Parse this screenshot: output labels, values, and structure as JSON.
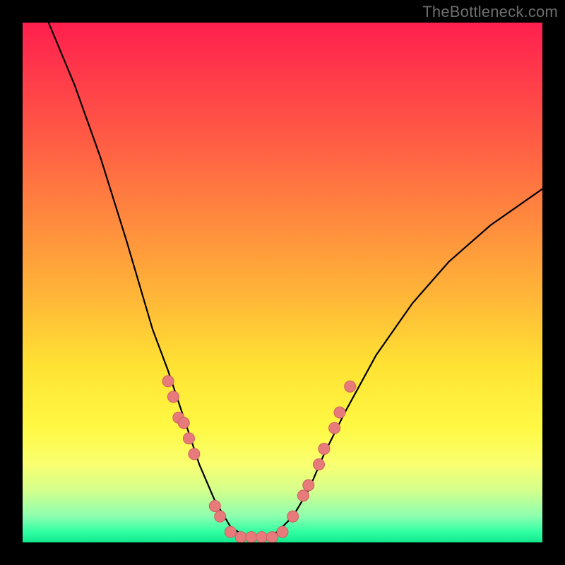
{
  "watermark": "TheBottleneck.com",
  "chart_data": {
    "type": "line",
    "title": "",
    "xlabel": "",
    "ylabel": "",
    "xlim": [
      0,
      100
    ],
    "ylim": [
      0,
      100
    ],
    "curve": [
      {
        "x": 5,
        "y": 100
      },
      {
        "x": 10,
        "y": 88
      },
      {
        "x": 15,
        "y": 74
      },
      {
        "x": 20,
        "y": 58
      },
      {
        "x": 25,
        "y": 41
      },
      {
        "x": 28,
        "y": 33
      },
      {
        "x": 31,
        "y": 24
      },
      {
        "x": 34,
        "y": 15
      },
      {
        "x": 37,
        "y": 8
      },
      {
        "x": 40,
        "y": 3
      },
      {
        "x": 43,
        "y": 1
      },
      {
        "x": 46,
        "y": 1
      },
      {
        "x": 49,
        "y": 2
      },
      {
        "x": 52,
        "y": 5
      },
      {
        "x": 55,
        "y": 10
      },
      {
        "x": 58,
        "y": 17
      },
      {
        "x": 62,
        "y": 25
      },
      {
        "x": 68,
        "y": 36
      },
      {
        "x": 75,
        "y": 46
      },
      {
        "x": 82,
        "y": 54
      },
      {
        "x": 90,
        "y": 61
      },
      {
        "x": 100,
        "y": 68
      }
    ],
    "points": [
      {
        "x": 28,
        "y": 31
      },
      {
        "x": 29,
        "y": 28
      },
      {
        "x": 30,
        "y": 24
      },
      {
        "x": 31,
        "y": 23
      },
      {
        "x": 32,
        "y": 20
      },
      {
        "x": 33,
        "y": 17
      },
      {
        "x": 37,
        "y": 7
      },
      {
        "x": 38,
        "y": 5
      },
      {
        "x": 40,
        "y": 2
      },
      {
        "x": 42,
        "y": 1
      },
      {
        "x": 44,
        "y": 1
      },
      {
        "x": 46,
        "y": 1
      },
      {
        "x": 48,
        "y": 1
      },
      {
        "x": 50,
        "y": 2
      },
      {
        "x": 52,
        "y": 5
      },
      {
        "x": 54,
        "y": 9
      },
      {
        "x": 55,
        "y": 11
      },
      {
        "x": 57,
        "y": 15
      },
      {
        "x": 58,
        "y": 18
      },
      {
        "x": 60,
        "y": 22
      },
      {
        "x": 61,
        "y": 25
      },
      {
        "x": 63,
        "y": 30
      }
    ],
    "background_gradient": {
      "top": "#ff1f4f",
      "mid": "#ffe233",
      "bottom": "#12e88e"
    }
  }
}
